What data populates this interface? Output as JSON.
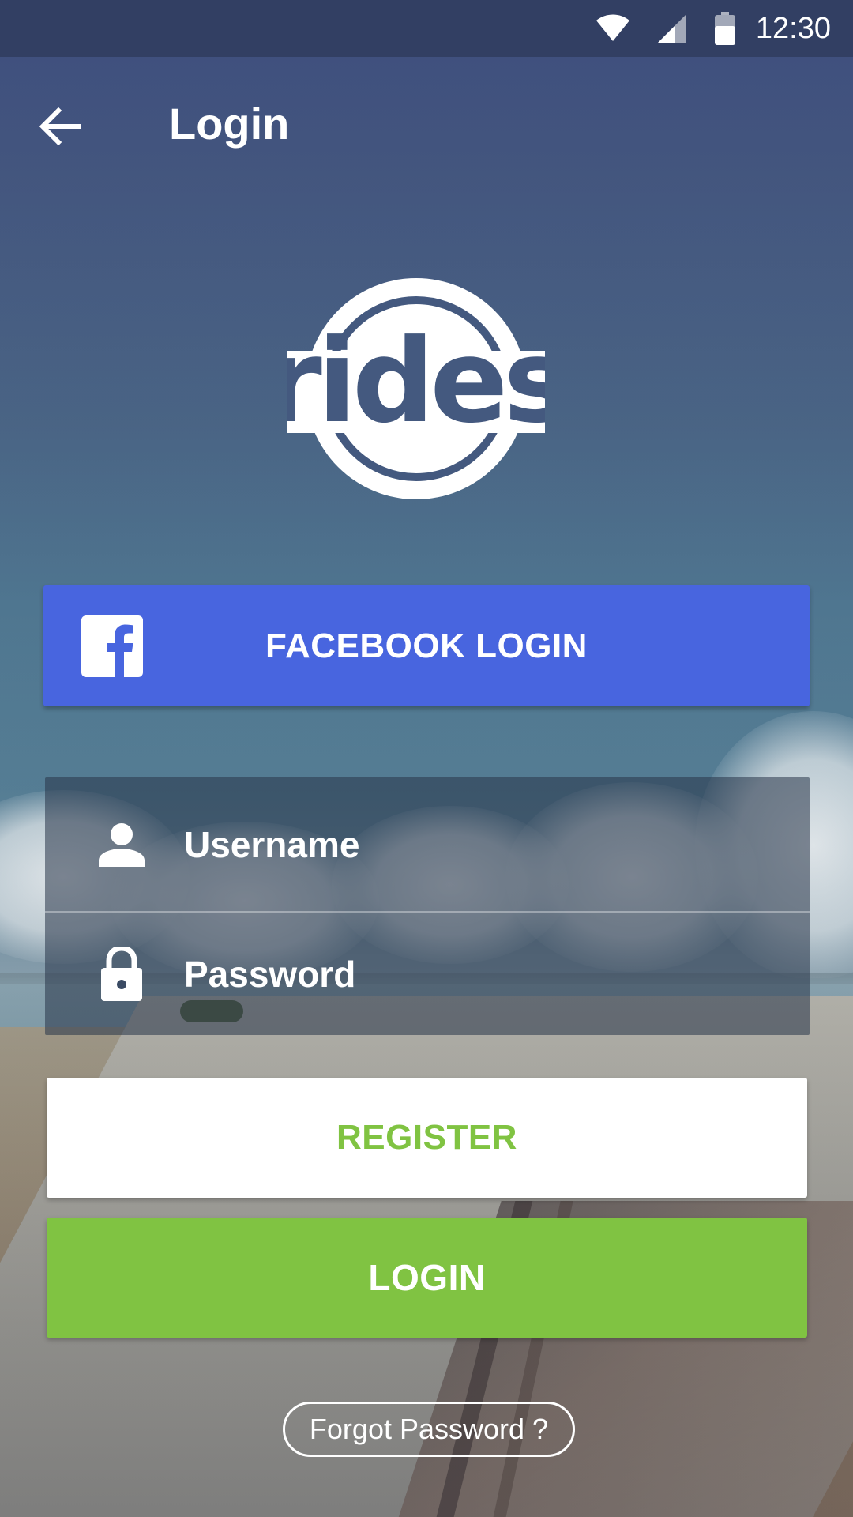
{
  "status_bar": {
    "time": "12:30",
    "icons": [
      "wifi-icon",
      "cell-signal-icon",
      "battery-icon"
    ]
  },
  "app_bar": {
    "title": "Login",
    "back_icon": "arrow-back-icon"
  },
  "logo": {
    "text": "rides",
    "color": "#ffffff"
  },
  "facebook": {
    "label": "FACEBOOK LOGIN",
    "icon": "facebook-icon",
    "color": "#4865df"
  },
  "form": {
    "username": {
      "placeholder": "Username",
      "value": "",
      "icon": "person-icon"
    },
    "password": {
      "placeholder": "Password",
      "value": "",
      "icon": "lock-icon"
    }
  },
  "actions": {
    "register_label": "REGISTER",
    "login_label": "LOGIN",
    "forgot_label": "Forgot Password ?",
    "accent_green": "#80c342"
  }
}
